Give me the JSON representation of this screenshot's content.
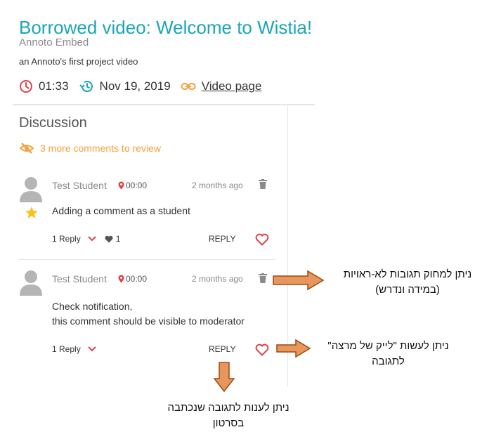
{
  "video": {
    "title": "Borrowed video: Welcome to Wistia!",
    "subtitle": "Annoto Embed",
    "description": "an Annoto's first project video",
    "duration": "01:33",
    "date": "Nov 19, 2019",
    "page_link": "Video page"
  },
  "discussion": {
    "title": "Discussion",
    "review_notice": "3 more comments to review"
  },
  "comments": [
    {
      "author": "Test Student",
      "timestamp": "00:00",
      "ago": "2 months ago",
      "text_lines": [
        "Adding a comment as a student"
      ],
      "replies": "1 Reply",
      "likes": "1",
      "reply_label": "REPLY"
    },
    {
      "author": "Test Student",
      "timestamp": "00:00",
      "ago": "2 months ago",
      "text_lines": [
        "Check notification,",
        "this comment should be visible to moderator"
      ],
      "replies": "1 Reply",
      "reply_label": "REPLY"
    }
  ],
  "annotations": {
    "delete_note": [
      "ניתן למחוק תגובות לא-ראויות",
      "(במידה ונדרש)"
    ],
    "like_note": [
      "ניתן לעשות \"לייק של מרצה\"",
      "לתגובה"
    ],
    "reply_note": [
      "ניתן לענות לתגובה שנכתבה",
      "בסרטון"
    ]
  },
  "colors": {
    "title": "#1aa6b7",
    "accent_orange": "#f5a13a",
    "alert_red": "#e0424b",
    "arrow_fill": "#e9965c",
    "arrow_stroke": "#9a4a14"
  }
}
